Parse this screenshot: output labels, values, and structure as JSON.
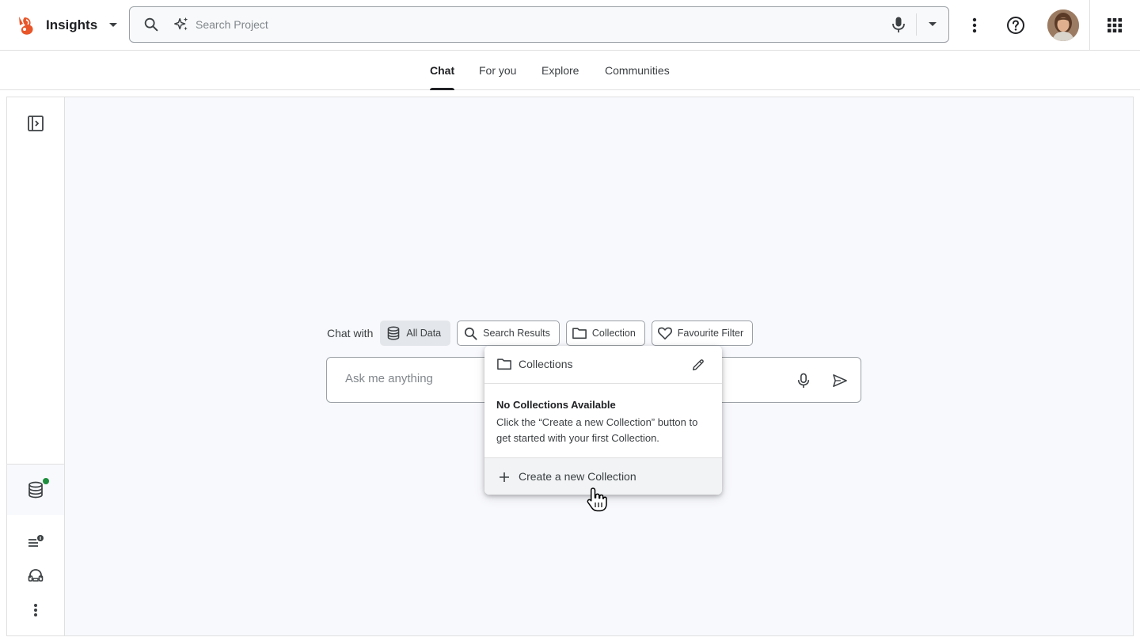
{
  "header": {
    "app_title": "Insights",
    "search_placeholder": "Search Project"
  },
  "tabs": [
    {
      "label": "Chat",
      "active": true
    },
    {
      "label": "For you",
      "active": false
    },
    {
      "label": "Explore",
      "active": false
    },
    {
      "label": "Communities",
      "active": false
    }
  ],
  "chat": {
    "chat_with_label": "Chat with",
    "chips": [
      {
        "label": "All Data",
        "icon": "database-icon",
        "selected": true
      },
      {
        "label": "Search Results",
        "icon": "search-icon",
        "selected": false
      },
      {
        "label": "Collection",
        "icon": "folder-icon",
        "selected": false
      },
      {
        "label": "Favourite Filter",
        "icon": "heart-icon",
        "selected": false
      }
    ],
    "input_placeholder": "Ask me anything"
  },
  "collections_popup": {
    "title": "Collections",
    "empty_title": "No Collections Available",
    "empty_description": "Click the “Create a new Collection” button to get started with your first Collection.",
    "create_label": "Create a new Collection"
  },
  "colors": {
    "accent_dark": "#202124",
    "status_dot": "#1e8e3e",
    "logo_orange": "#e8562a"
  }
}
